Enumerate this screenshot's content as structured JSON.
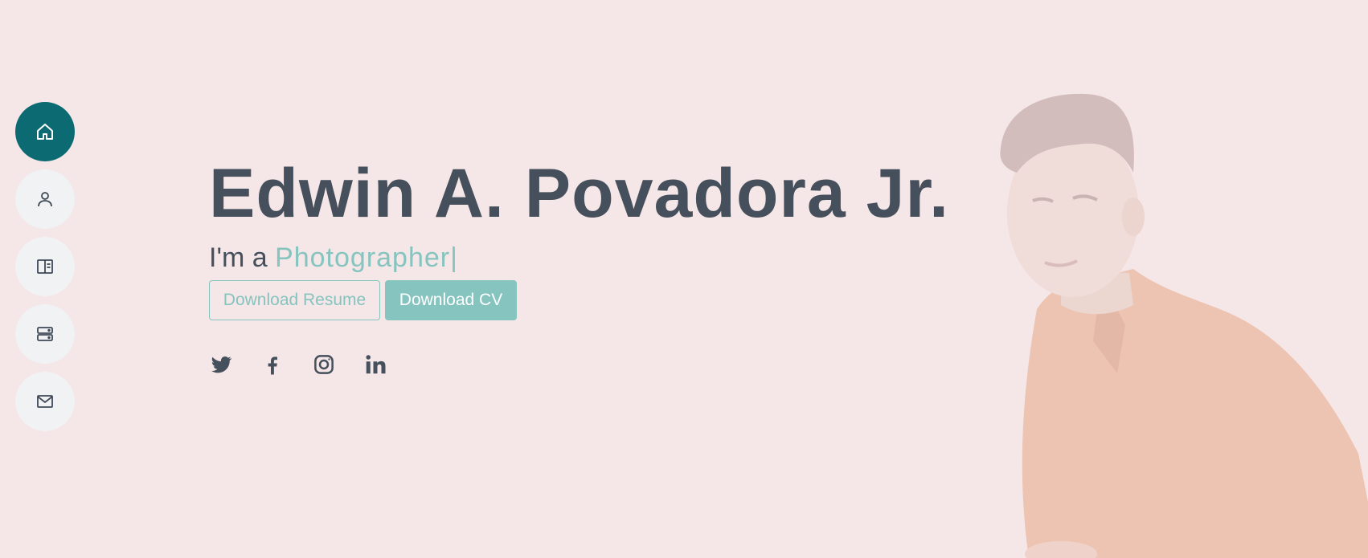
{
  "nav": {
    "items": [
      {
        "icon": "home-icon",
        "active": true
      },
      {
        "icon": "person-icon",
        "active": false
      },
      {
        "icon": "book-icon",
        "active": false
      },
      {
        "icon": "server-icon",
        "active": false
      },
      {
        "icon": "mail-icon",
        "active": false
      }
    ]
  },
  "hero": {
    "name": "Edwin A. Povadora Jr.",
    "role_prefix": "I'm a ",
    "role_typed": "Photographer|",
    "download_resume_label": "Download Resume",
    "download_cv_label": "Download CV",
    "social": [
      "twitter-icon",
      "facebook-icon",
      "instagram-icon",
      "linkedin-icon"
    ]
  },
  "colors": {
    "background": "#f5e6e7",
    "accent": "#86c4bf",
    "nav_active": "#0b6a72",
    "text": "#46505c"
  }
}
